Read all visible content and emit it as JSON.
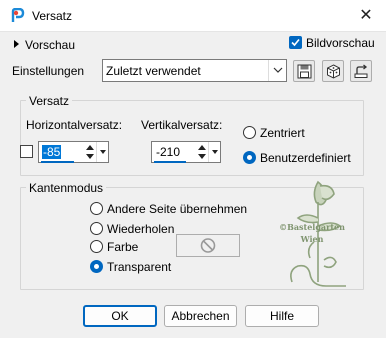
{
  "window": {
    "title": "Versatz",
    "close_glyph": "✕",
    "app_icon": "psp-logo-icon"
  },
  "top": {
    "preview_label": "Vorschau",
    "image_preview_label": "Bildvorschau",
    "image_preview_checked": true
  },
  "settings": {
    "label": "Einstellungen",
    "preset_value": "Zuletzt verwendet",
    "icons": [
      "save-preset-icon",
      "load-preset-icon",
      "reset-icon"
    ]
  },
  "offset": {
    "group_title": "Versatz",
    "horizontal_label": "Horizontalversatz:",
    "horizontal_value": "-85",
    "vertical_label": "Vertikalversatz:",
    "vertical_value": "-210",
    "link_checked": false,
    "centered_label": "Zentriert",
    "custom_label": "Benutzerdefiniert",
    "selected": "custom"
  },
  "edge_mode": {
    "group_title": "Kantenmodus",
    "options": [
      "Andere Seite übernehmen",
      "Wiederholen",
      "Farbe",
      "Transparent"
    ],
    "selected": "Transparent",
    "color_swatch_icon": "no-color-icon"
  },
  "watermark": {
    "line1": "©Bastelgarten",
    "line2": "Wien"
  },
  "buttons": {
    "ok": "OK",
    "cancel": "Abbrechen",
    "help": "Hilfe"
  },
  "colors": {
    "accent": "#0067c0",
    "selection": "#0078d7",
    "background": "#f0f0f0",
    "watermark": "#8fa37e"
  }
}
